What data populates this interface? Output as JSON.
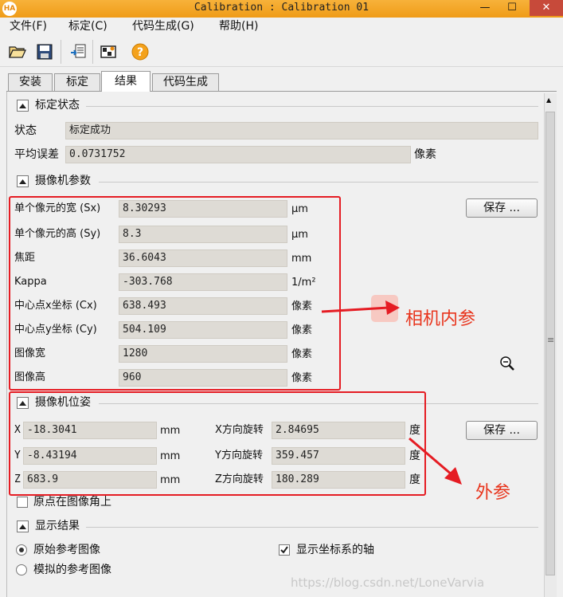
{
  "window": {
    "title": "Calibration : Calibration 01",
    "logo_text": "HA",
    "minimize_glyph": "—",
    "maximize_glyph": "☐",
    "close_glyph": "✕"
  },
  "menu": [
    "文件(F)",
    "标定(C)",
    "代码生成(G)",
    "帮助(H)"
  ],
  "toolbar": {
    "icons": [
      "open-folder-icon",
      "save-disk-icon",
      "export-code-icon",
      "image-view-icon",
      "help-icon"
    ],
    "help_glyph": "?"
  },
  "tabs": [
    {
      "label": "安装",
      "active": false
    },
    {
      "label": "标定",
      "active": false
    },
    {
      "label": "结果",
      "active": true
    },
    {
      "label": "代码生成",
      "active": false
    }
  ],
  "status_section": {
    "title": "标定状态",
    "state_label": "状态",
    "state_value": "标定成功",
    "error_label": "平均误差",
    "error_value": "0.0731752",
    "error_unit": "像素"
  },
  "camera_params": {
    "title": "摄像机参数",
    "save_button": "保存 ...",
    "rows": [
      {
        "label": "单个像元的宽 (Sx)",
        "value": "8.30293",
        "unit": "µm"
      },
      {
        "label": "单个像元的高 (Sy)",
        "value": "8.3",
        "unit": "µm"
      },
      {
        "label": "焦距",
        "value": "36.6043",
        "unit": "mm"
      },
      {
        "label": "Kappa",
        "value": "-303.768",
        "unit": "1/m²"
      },
      {
        "label": "中心点x坐标 (Cx)",
        "value": "638.493",
        "unit": "像素"
      },
      {
        "label": "中心点y坐标 (Cy)",
        "value": "504.109",
        "unit": "像素"
      },
      {
        "label": "图像宽",
        "value": "1280",
        "unit": "像素"
      },
      {
        "label": "图像高",
        "value": "960",
        "unit": "像素"
      }
    ]
  },
  "camera_pose": {
    "title": "摄像机位姿",
    "save_button": "保存 ...",
    "translations": [
      {
        "label": "X",
        "value": "-18.3041",
        "unit": "mm"
      },
      {
        "label": "Y",
        "value": "-8.43194",
        "unit": "mm"
      },
      {
        "label": "Z",
        "value": "683.9",
        "unit": "mm"
      }
    ],
    "rotations": [
      {
        "label": "X方向旋转",
        "value": "2.84695",
        "unit": "度"
      },
      {
        "label": "Y方向旋转",
        "value": "359.457",
        "unit": "度"
      },
      {
        "label": "Z方向旋转",
        "value": "180.289",
        "unit": "度"
      }
    ],
    "origin_checkbox": "原点在图像角上",
    "origin_checked": false
  },
  "display_section": {
    "title": "显示结果",
    "radio_original": "原始参考图像",
    "radio_original_selected": true,
    "radio_simulated": "模拟的参考图像",
    "radio_simulated_selected": false,
    "show_axes": "显示坐标系的轴",
    "show_axes_checked": true
  },
  "annotations": {
    "intrinsic": "相机内参",
    "extrinsic": "外参",
    "color": "#e51c23"
  },
  "watermark": "https://blog.csdn.net/LoneVarvia"
}
